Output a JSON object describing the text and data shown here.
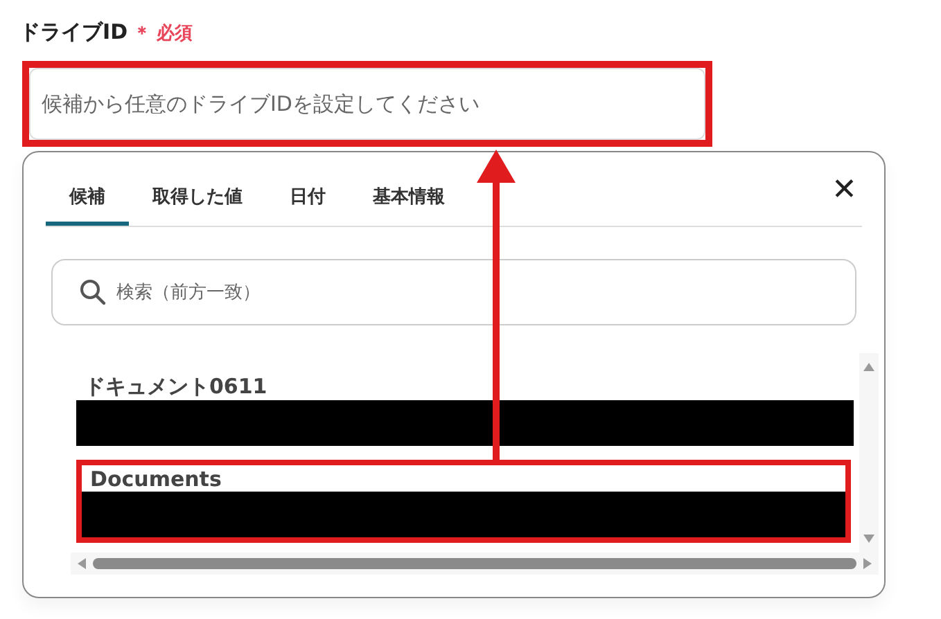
{
  "field": {
    "label": "ドライブID",
    "required_mark": "＊",
    "required_text": "必須",
    "placeholder": "候補から任意のドライブIDを設定してください",
    "highlighted": true
  },
  "popup": {
    "tabs": [
      {
        "label": "候補",
        "selected": true
      },
      {
        "label": "取得した値",
        "selected": false
      },
      {
        "label": "日付",
        "selected": false
      },
      {
        "label": "基本情報",
        "selected": false
      }
    ],
    "close": "✕",
    "search": {
      "placeholder": "検索（前方一致）"
    },
    "items": [
      {
        "title": "ドキュメント0611",
        "redacted": true,
        "highlighted": false
      },
      {
        "title": "Documents",
        "redacted": true,
        "highlighted": true
      }
    ]
  },
  "annotation": {
    "arrow": true
  }
}
